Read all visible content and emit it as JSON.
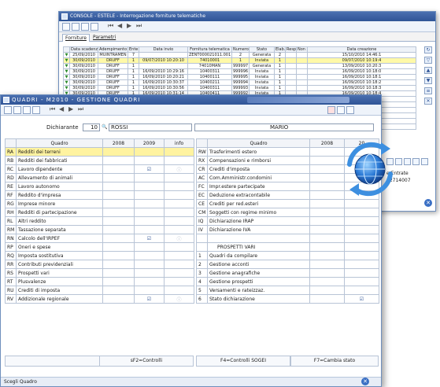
{
  "back_window": {
    "title": "CONSOLE - ESTELE - Interrogazione forniture telematiche",
    "tabs": [
      "Forniture",
      "Parametri"
    ],
    "columns": [
      "",
      "Data scadenza",
      "Adempimento",
      "Ente",
      "Data invio",
      "Fornitura telematica",
      "Numero",
      "Stato",
      "Elab.",
      "Resp",
      "Non p",
      "Data creazione"
    ],
    "rows": [
      [
        "▼",
        "25/09/2010",
        "MUINTRAMEN",
        "7",
        "",
        "ZENT000021011.001",
        "2",
        "Generata",
        "2",
        "",
        "",
        "15/10/2010 14:46:1"
      ],
      [
        "▼",
        "30/09/2010",
        "DRUFF",
        "1",
        "09/07/2010 10:20:10",
        "74010001",
        "1",
        "Inviata",
        "1",
        "",
        "",
        "09/07/2010 10:19:4"
      ],
      [
        "▼",
        "30/09/2010",
        "DRUFF",
        "1",
        "",
        "74010MAN",
        "999997",
        "Generata",
        "1",
        "",
        "",
        "13/09/2010 10:20:3"
      ],
      [
        "▼",
        "30/09/2010",
        "DRUFF",
        "1",
        "16/09/2010 10:29:16",
        "10400311",
        "999996",
        "Inviata",
        "1",
        "",
        "",
        "16/09/2010 10:18:0"
      ],
      [
        "▼",
        "30/09/2010",
        "DRUFF",
        "1",
        "16/09/2010 10:20:21",
        "10400111",
        "999995",
        "Inviata",
        "1",
        "",
        "",
        "16/09/2010 10:18:1"
      ],
      [
        "▼",
        "30/09/2010",
        "DRUFF",
        "1",
        "16/09/2010 10:30:37",
        "10400211",
        "999994",
        "Inviata",
        "1",
        "",
        "",
        "16/09/2010 10:18:2"
      ],
      [
        "▼",
        "30/09/2010",
        "DRUFF",
        "1",
        "16/09/2010 10:30:56",
        "10400311",
        "999993",
        "Inviata",
        "1",
        "",
        "",
        "16/09/2010 10:18:3"
      ],
      [
        "▼",
        "30/09/2010",
        "DRUFF",
        "1",
        "16/09/2010 10:31:14",
        "10400411",
        "999992",
        "Inviata",
        "1",
        "",
        "",
        "16/09/2010 10:18:4"
      ]
    ],
    "extra_rows": [
      "16/09/2010 10:24:2",
      "16/09/2010 15:33:0",
      "16/09/2010 15:33:1",
      "16/09/2010 15:27:4",
      "16/09/2010 15:28:0",
      "16/09/2010 15:28:2"
    ],
    "right_label_1": "e Entrate",
    "right_label_2": "72714007"
  },
  "front_window": {
    "title": "QUADRI - M2010 - GESTIONE QUADRI",
    "dichiarante_label": "Dichiarante",
    "dichiarante_code": "10",
    "surname": "ROSSI",
    "firstname": "MARIO",
    "left_columns": [
      "",
      "Quadro",
      "2008",
      "2009",
      "info"
    ],
    "right_columns": [
      "",
      "Quadro",
      "2008",
      "20"
    ],
    "left_rows": [
      {
        "code": "RA",
        "name": "Redditi dei terreni",
        "icon": "",
        "info": ""
      },
      {
        "code": "RB",
        "name": "Redditi dei fabbricati",
        "icon": "",
        "info": ""
      },
      {
        "code": "RC",
        "name": "Lavoro dipendente",
        "icon": "☑",
        "info": "ⓘ"
      },
      {
        "code": "RD",
        "name": "Allevamento di animali",
        "icon": "",
        "info": ""
      },
      {
        "code": "RE",
        "name": "Lavoro autonomo",
        "icon": "",
        "info": ""
      },
      {
        "code": "RF",
        "name": "Reddito d'impresa",
        "icon": "",
        "info": ""
      },
      {
        "code": "RG",
        "name": "Imprese minore",
        "icon": "",
        "info": ""
      },
      {
        "code": "RH",
        "name": "Redditi di partecipazione",
        "icon": "",
        "info": ""
      },
      {
        "code": "RL",
        "name": "Altri reddito",
        "icon": "",
        "info": ""
      },
      {
        "code": "RM",
        "name": "Tassazione separata",
        "icon": "",
        "info": ""
      },
      {
        "code": "RN",
        "name": "Calcolo dell'IRPEF",
        "icon": "☑",
        "info": "ⓘ"
      },
      {
        "code": "RP",
        "name": "Oneri e spese",
        "icon": "",
        "info": ""
      },
      {
        "code": "RQ",
        "name": "Imposta sostitutiva",
        "icon": "",
        "info": ""
      },
      {
        "code": "RR",
        "name": "Contributi previdenziali",
        "icon": "",
        "info": ""
      },
      {
        "code": "RS",
        "name": "Prospetti vari",
        "icon": "",
        "info": ""
      },
      {
        "code": "RT",
        "name": "Plusvalenze",
        "icon": "",
        "info": ""
      },
      {
        "code": "RU",
        "name": "Crediti di imposta",
        "icon": "",
        "info": ""
      },
      {
        "code": "RV",
        "name": "Addizionale regionale",
        "icon": "☑",
        "info": "ⓘ"
      }
    ],
    "right_rows": [
      {
        "code": "RW",
        "name": "Trasferimenti estero",
        "icon": ""
      },
      {
        "code": "RX",
        "name": "Compensazioni e rimborsi",
        "icon": ""
      },
      {
        "code": "CR",
        "name": "Crediti d'imposta",
        "icon": ""
      },
      {
        "code": "AC",
        "name": "Com.Amministr.condomini",
        "icon": ""
      },
      {
        "code": "FC",
        "name": "Impr.estere partecipate",
        "icon": ""
      },
      {
        "code": "EC",
        "name": "Deduzione extracontabile",
        "icon": ""
      },
      {
        "code": "CE",
        "name": "Crediti per red.esteri",
        "icon": ""
      },
      {
        "code": "CM",
        "name": "Soggetti con regime minimo",
        "icon": ""
      },
      {
        "code": "IQ",
        "name": "Dichiarazione IRAP",
        "icon": ""
      },
      {
        "code": "IV",
        "name": "Dichiarazione IVA",
        "icon": ""
      },
      {
        "code": "",
        "name": "",
        "icon": ""
      },
      {
        "code": "",
        "name": "PROSPETTI VARI",
        "icon": ""
      },
      {
        "code": "1",
        "name": "Quadri da compilare",
        "icon": ""
      },
      {
        "code": "2",
        "name": "Gestione acconti",
        "icon": ""
      },
      {
        "code": "3",
        "name": "Gestione anagrafiche",
        "icon": ""
      },
      {
        "code": "4",
        "name": "Gestione prospetti",
        "icon": ""
      },
      {
        "code": "5",
        "name": "Versamenti e rateizzaz.",
        "icon": ""
      },
      {
        "code": "6",
        "name": "Stato dichiarazione",
        "icon": "☑"
      }
    ],
    "btn_controlli": "sF2=Controlli",
    "btn_sogei": "F4=Controlli SOGEI",
    "btn_stato": "F7=Cambia stato",
    "status": "Scegli Quadro"
  },
  "colors": {
    "titlebar": "#2f5496",
    "selected_row": "#fff3a0",
    "border": "#b8c4d6"
  }
}
